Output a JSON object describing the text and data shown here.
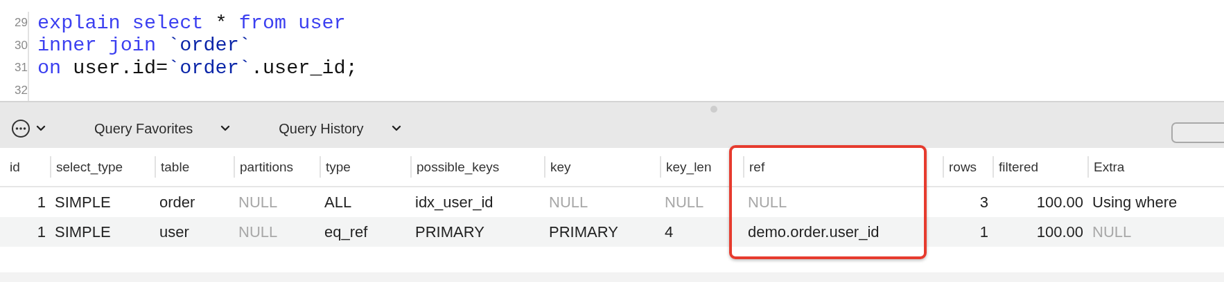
{
  "editor": {
    "lines": [
      {
        "number": "29",
        "tokens": [
          {
            "kind": "keyword",
            "text": "explain select "
          },
          {
            "kind": "plain",
            "text": "* "
          },
          {
            "kind": "keyword",
            "text": "from user"
          }
        ]
      },
      {
        "number": "30",
        "tokens": [
          {
            "kind": "keyword",
            "text": "inner join "
          },
          {
            "kind": "quoted",
            "text": "`order`"
          }
        ]
      },
      {
        "number": "31",
        "tokens": [
          {
            "kind": "keyword",
            "text": "on "
          },
          {
            "kind": "plain",
            "text": "user.id="
          },
          {
            "kind": "quoted",
            "text": "`order`"
          },
          {
            "kind": "plain",
            "text": ".user_id;"
          }
        ]
      },
      {
        "number": "32"
      }
    ]
  },
  "toolbar": {
    "menus": [
      {
        "kind": "icon"
      },
      {
        "kind": "label",
        "label": "Query Favorites"
      },
      {
        "kind": "label",
        "label": "Query History"
      }
    ]
  },
  "table": {
    "columns": [
      {
        "label": "id",
        "kind": "number"
      },
      {
        "label": "select_type"
      },
      {
        "label": "table"
      },
      {
        "label": "partitions"
      },
      {
        "label": "type"
      },
      {
        "label": "possible_keys"
      },
      {
        "label": "key"
      },
      {
        "label": "key_len"
      },
      {
        "label": "ref"
      },
      {
        "label": "rows",
        "kind": "number"
      },
      {
        "label": "filtered",
        "kind": "number"
      },
      {
        "label": "Extra"
      }
    ],
    "rows": [
      {
        "cells": [
          {
            "text": "1"
          },
          {
            "text": "SIMPLE"
          },
          {
            "text": "order"
          },
          {
            "text": "NULL",
            "muted": true
          },
          {
            "text": "ALL"
          },
          {
            "text": "idx_user_id"
          },
          {
            "text": "NULL",
            "muted": true
          },
          {
            "text": "NULL",
            "muted": true
          },
          {
            "text": "NULL",
            "muted": true
          },
          {
            "text": "3"
          },
          {
            "text": "100.00"
          },
          {
            "text": "Using where"
          }
        ]
      },
      {
        "cells": [
          {
            "text": "1"
          },
          {
            "text": "SIMPLE"
          },
          {
            "text": "user"
          },
          {
            "text": "NULL",
            "muted": true
          },
          {
            "text": "eq_ref"
          },
          {
            "text": "PRIMARY"
          },
          {
            "text": "PRIMARY"
          },
          {
            "text": "4"
          },
          {
            "text": "demo.order.user_id"
          },
          {
            "text": "1"
          },
          {
            "text": "100.00"
          },
          {
            "text": "NULL",
            "muted": true
          }
        ]
      }
    ]
  }
}
